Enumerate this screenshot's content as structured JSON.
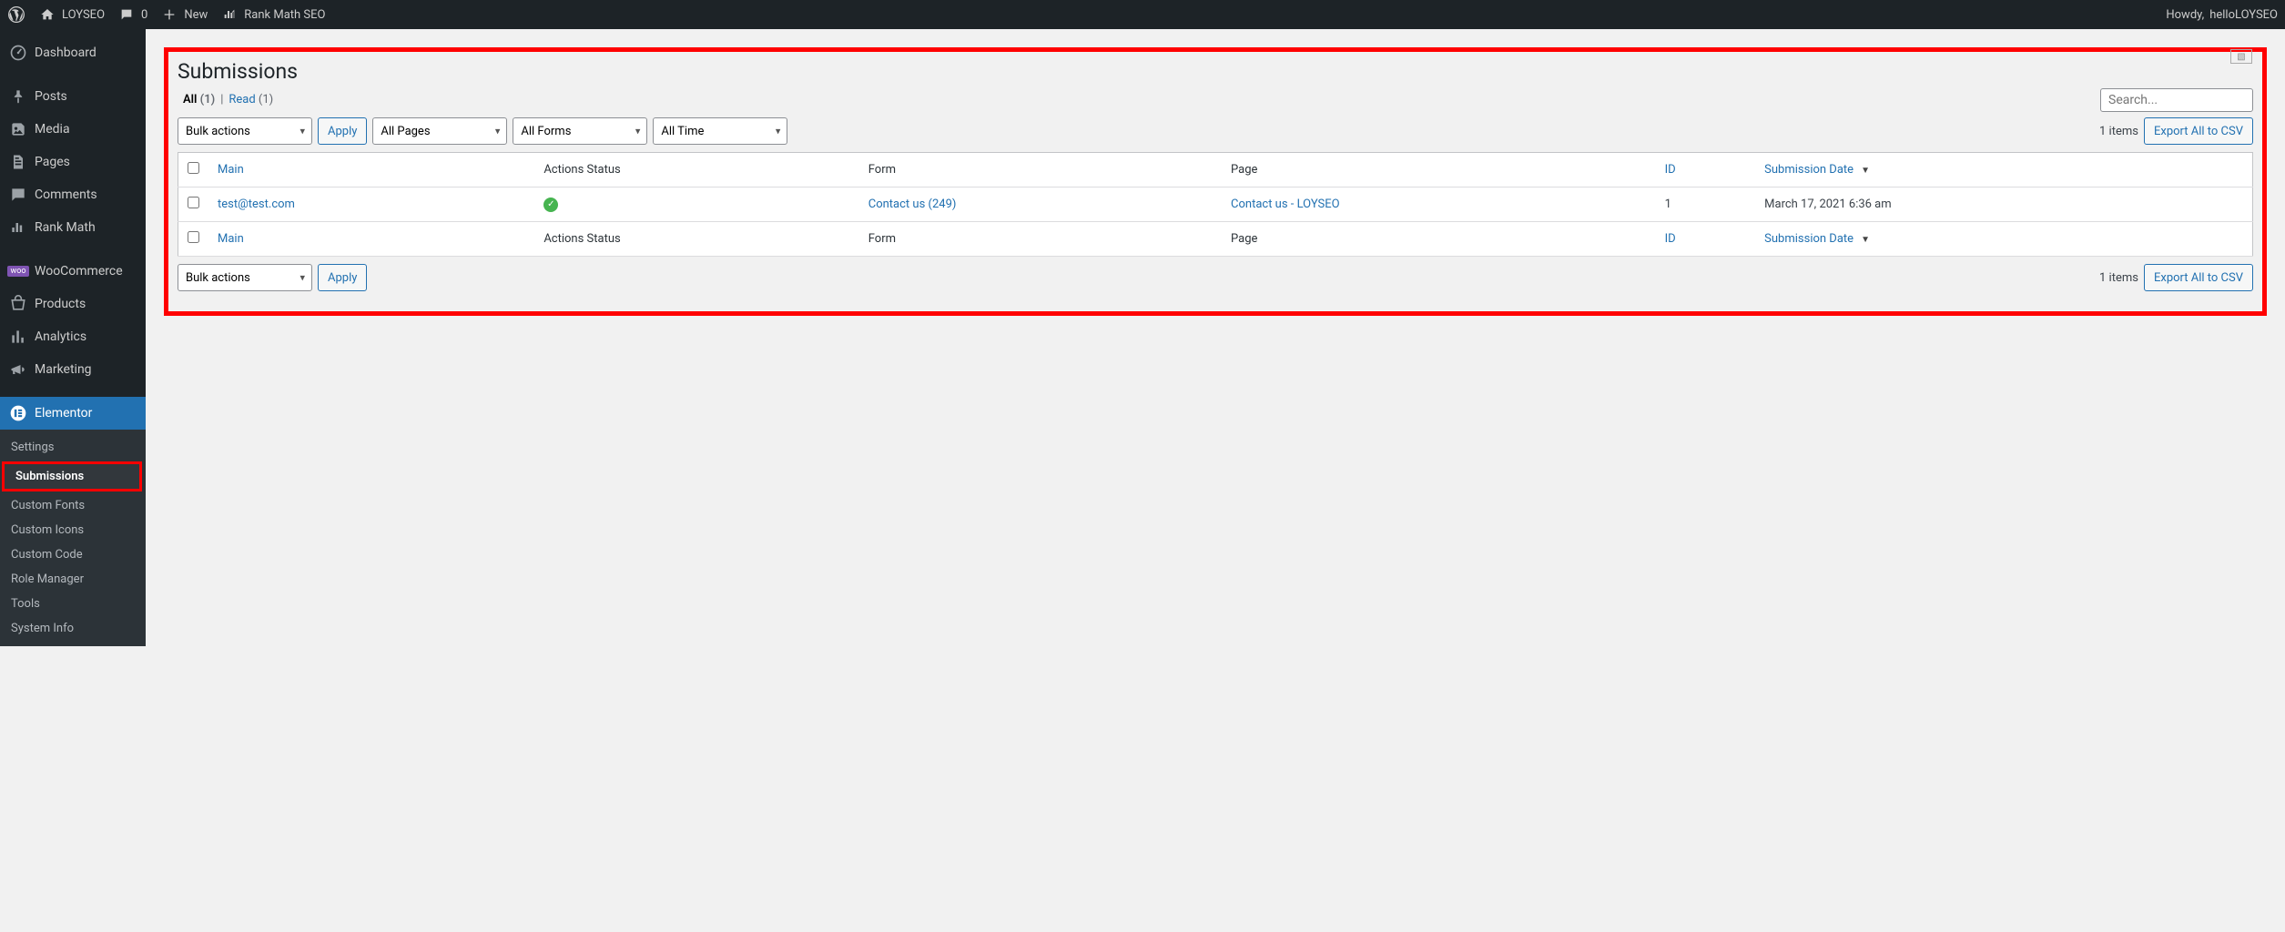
{
  "topbar": {
    "site_name": "LOYSEO",
    "comments_count": "0",
    "new_label": "New",
    "rankmath_label": "Rank Math SEO",
    "howdy_prefix": "Howdy, ",
    "user_name": "helloLOYSEO"
  },
  "sidebar": {
    "items": [
      {
        "label": "Dashboard",
        "icon": "dashboard"
      },
      {
        "label": "Posts",
        "icon": "pin"
      },
      {
        "label": "Media",
        "icon": "media"
      },
      {
        "label": "Pages",
        "icon": "pages"
      },
      {
        "label": "Comments",
        "icon": "comments"
      },
      {
        "label": "Rank Math",
        "icon": "rankmath"
      },
      {
        "label": "WooCommerce",
        "icon": "woo"
      },
      {
        "label": "Products",
        "icon": "products"
      },
      {
        "label": "Analytics",
        "icon": "analytics"
      },
      {
        "label": "Marketing",
        "icon": "marketing"
      },
      {
        "label": "Elementor",
        "icon": "elementor",
        "active": true
      }
    ],
    "submenu": [
      {
        "label": "Settings"
      },
      {
        "label": "Submissions",
        "current": true
      },
      {
        "label": "Custom Fonts"
      },
      {
        "label": "Custom Icons"
      },
      {
        "label": "Custom Code"
      },
      {
        "label": "Role Manager"
      },
      {
        "label": "Tools"
      },
      {
        "label": "System Info"
      }
    ]
  },
  "page": {
    "title": "Submissions",
    "filters": {
      "all_label": "All",
      "all_count": "(1)",
      "read_label": "Read",
      "read_count": "(1)"
    },
    "search_placeholder": "Search...",
    "bulk_actions_label": "Bulk actions",
    "apply_label": "Apply",
    "all_pages_label": "All Pages",
    "all_forms_label": "All Forms",
    "all_time_label": "All Time",
    "items_count": "1 items",
    "export_label": "Export All to CSV",
    "columns": {
      "main": "Main",
      "actions_status": "Actions Status",
      "form": "Form",
      "page": "Page",
      "id": "ID",
      "date": "Submission Date"
    },
    "rows": [
      {
        "main": "test@test.com",
        "status_ok": true,
        "form": "Contact us (249)",
        "page": "Contact us - LOYSEO",
        "id": "1",
        "date": "March 17, 2021 6:36 am"
      }
    ]
  }
}
